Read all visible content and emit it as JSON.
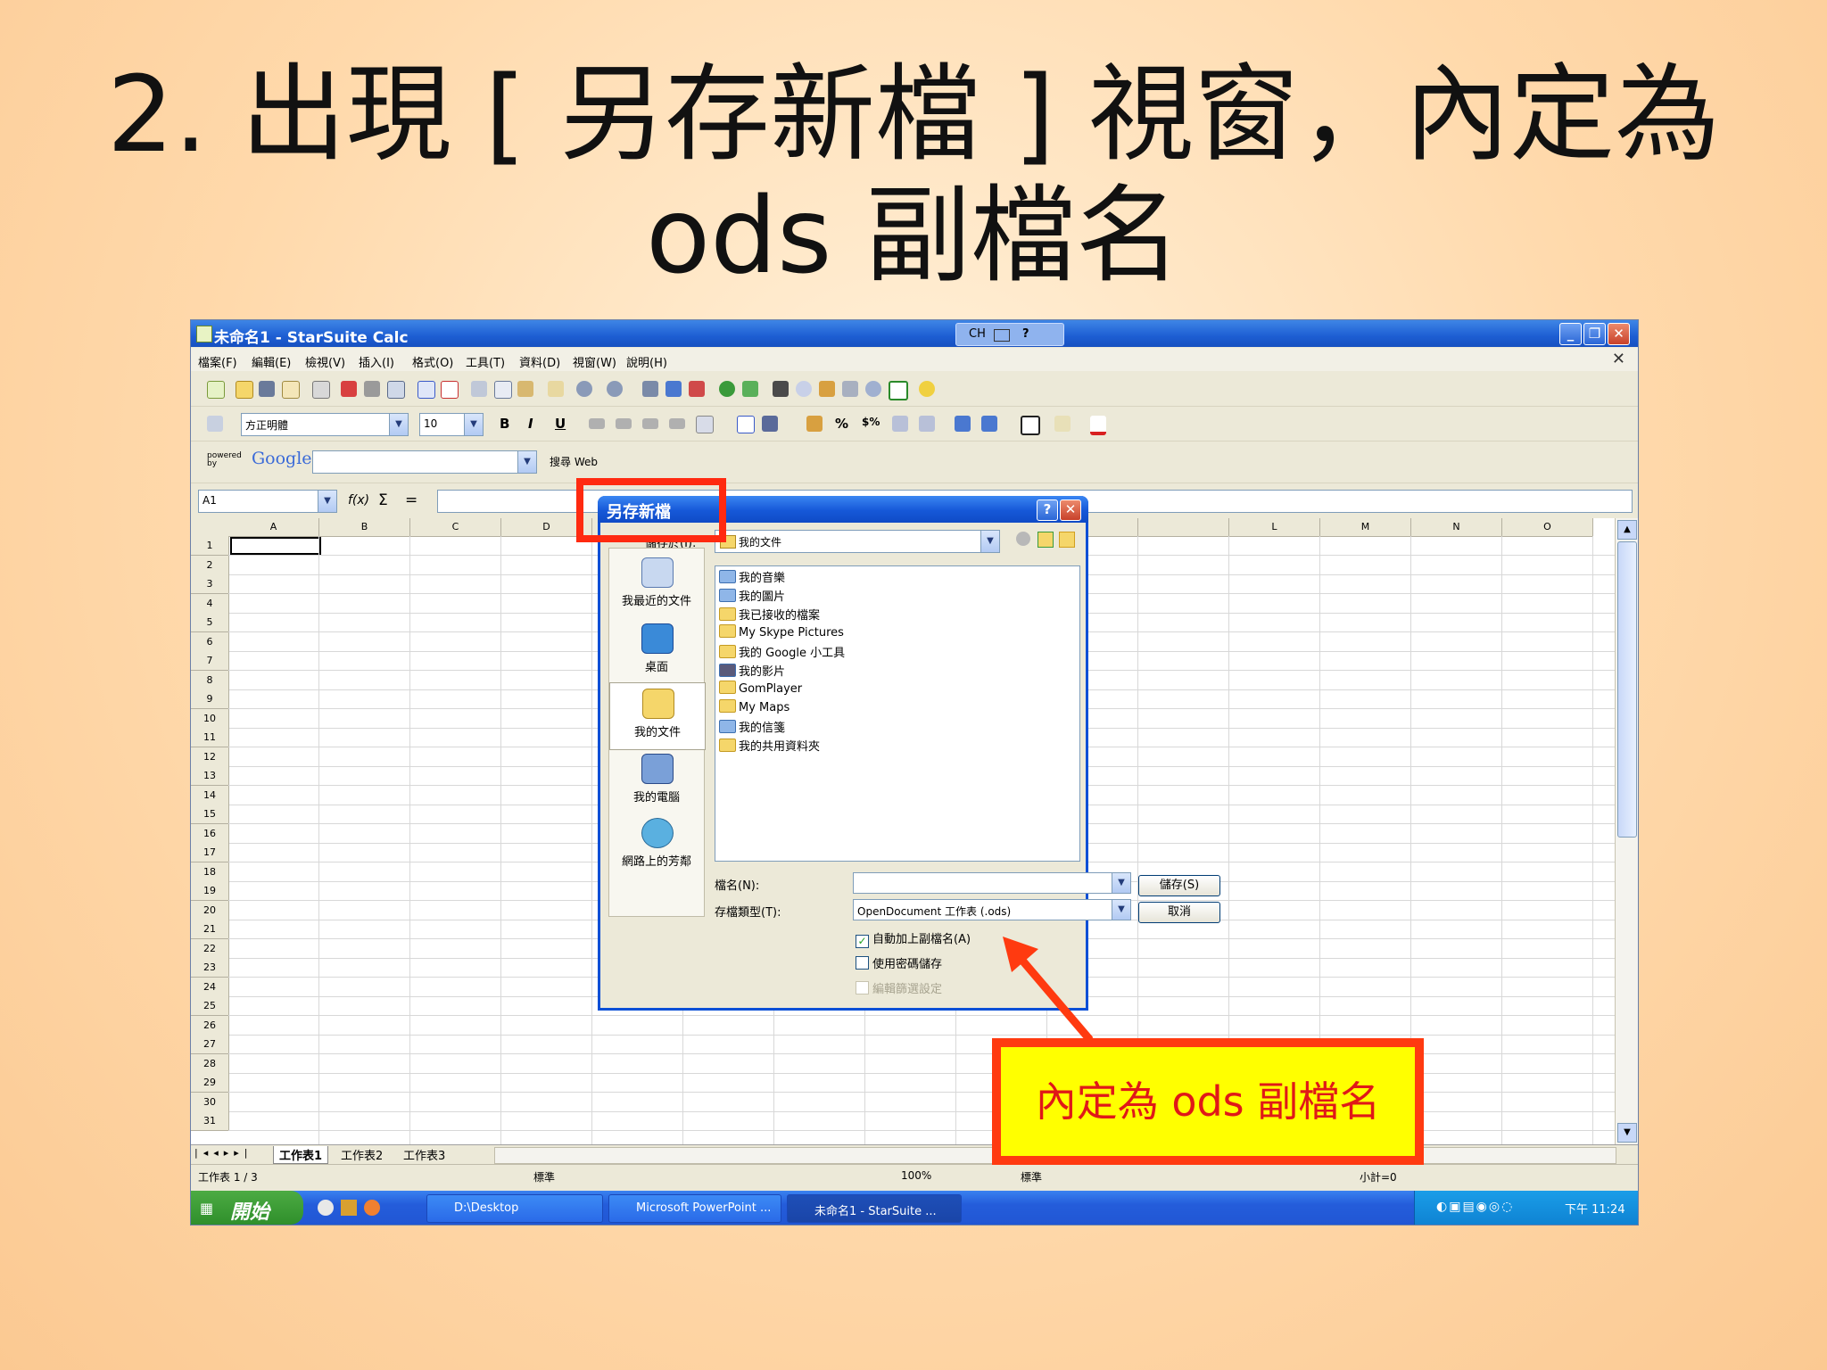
{
  "slide": {
    "title_line1": "2. 出現 [ 另存新檔 ] 視窗，內定為",
    "title_line2": "ods 副檔名",
    "callout": "內定為 ods 副檔名"
  },
  "window": {
    "title": "未命名1 - StarSuite Calc",
    "ime": {
      "lang": "CH",
      "help": "?"
    },
    "buttons": {
      "minimize": "_",
      "restore": "❐",
      "close": "✕"
    }
  },
  "menu": {
    "items": [
      "檔案(F)",
      "編輯(E)",
      "檢視(V)",
      "插入(I)",
      "格式(O)",
      "工具(T)",
      "資料(D)",
      "視窗(W)",
      "說明(H)"
    ],
    "close": "✕"
  },
  "format_toolbar": {
    "font_name": "方正明體",
    "font_size": "10",
    "bold": "B",
    "italic": "I",
    "underline": "U",
    "percent": "%",
    "currency": "$%"
  },
  "google_toolbar": {
    "powered_by": "powered by",
    "brand": "Google",
    "search_label": "搜尋 Web"
  },
  "formula_bar": {
    "cell_ref": "A1",
    "func": "f(x)",
    "sum": "Σ",
    "equals": "="
  },
  "grid": {
    "columns": [
      "A",
      "B",
      "C",
      "D",
      "",
      "",
      "",
      "",
      "",
      "",
      "",
      "L",
      "M",
      "N",
      "O"
    ],
    "rows": [
      "1",
      "2",
      "3",
      "4",
      "5",
      "6",
      "7",
      "8",
      "9",
      "10",
      "11",
      "12",
      "13",
      "14",
      "15",
      "16",
      "17",
      "18",
      "19",
      "20",
      "21",
      "22",
      "23",
      "24",
      "25",
      "26",
      "27",
      "28",
      "29",
      "30",
      "31"
    ]
  },
  "sheet_tabs": [
    "工作表1",
    "工作表2",
    "工作表3"
  ],
  "status_bar": {
    "sheet": "工作表 1 / 3",
    "style": "標準",
    "zoom": "100%",
    "mode": "標準",
    "sum": "小計=0"
  },
  "taskbar": {
    "start": "開始",
    "tasks": [
      "D:\\Desktop",
      "Microsoft PowerPoint ...",
      "未命名1 - StarSuite ..."
    ],
    "clock": "下午 11:24"
  },
  "dialog": {
    "title": "另存新檔",
    "save_in_label": "儲存於(I):",
    "save_in_value": "我的文件",
    "places": [
      "我最近的文件",
      "桌面",
      "我的文件",
      "我的電腦",
      "網路上的芳鄰"
    ],
    "files": [
      "我的音樂",
      "我的圖片",
      "我已接收的檔案",
      "My Skype Pictures",
      "我的 Google 小工具",
      "我的影片",
      "GomPlayer",
      "My Maps",
      "我的信箋",
      "我的共用資料夾"
    ],
    "filename_label": "檔名(N):",
    "filename_value": "",
    "filetype_label": "存檔類型(T):",
    "filetype_value": "OpenDocument 工作表 (.ods)",
    "save_button": "儲存(S)",
    "cancel_button": "取消",
    "auto_ext": "自動加上副檔名(A)",
    "password": "使用密碼儲存",
    "filter": "編輯篩選設定",
    "help": "?",
    "close": "✕"
  },
  "colors": {
    "highlight": "#ff2a10",
    "callout_bg": "#ffff00",
    "callout_text": "#e01818"
  }
}
